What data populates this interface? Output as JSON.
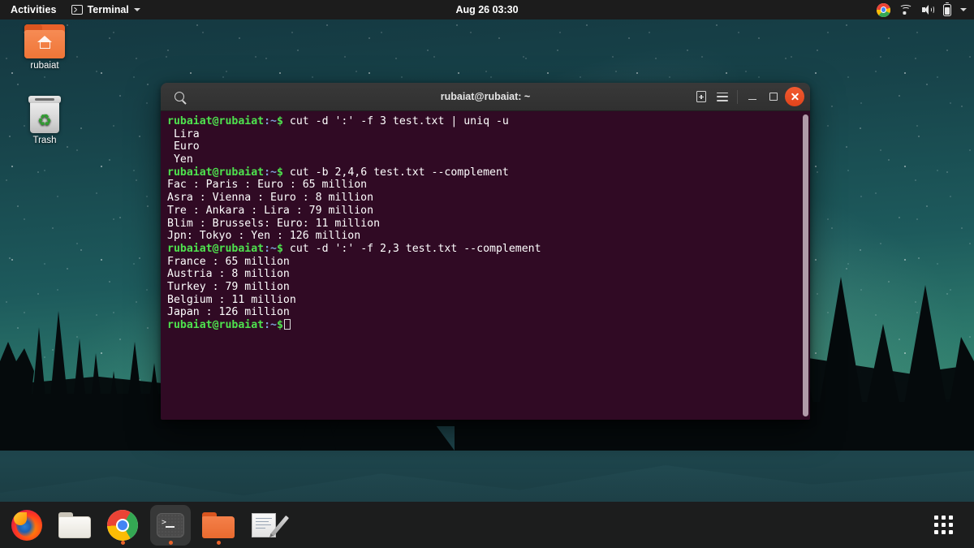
{
  "topbar": {
    "activities": "Activities",
    "app_menu": "Terminal",
    "app_icon": "terminal-icon",
    "clock": "Aug 26  03:30",
    "tray": [
      "chrome-icon",
      "wifi-icon",
      "volume-icon",
      "battery-icon",
      "chevron-down-icon"
    ]
  },
  "desktop_icons": [
    {
      "name": "rubaiat",
      "icon": "home-folder-icon"
    },
    {
      "name": "Trash",
      "icon": "trash-icon"
    }
  ],
  "terminal": {
    "title": "rubaiat@rubaiat: ~",
    "titlebar_buttons": {
      "search": "search-icon",
      "new_tab": "new-tab-icon",
      "menu": "hamburger-menu-icon",
      "minimize": "minimize-icon",
      "maximize": "maximize-icon",
      "close": "close-icon"
    },
    "colors": {
      "background": "#300a24",
      "prompt_user": "#4ee24e",
      "prompt_path": "#7f9fd6",
      "text": "#ffffff",
      "close_button": "#e2441b"
    },
    "prompt": {
      "user_host": "rubaiat@rubaiat",
      "path": ":~",
      "symbol": "$"
    },
    "lines": [
      {
        "type": "prompt",
        "command": " cut -d ':' -f 3 test.txt | uniq -u"
      },
      {
        "type": "output",
        "text": " Lira"
      },
      {
        "type": "output",
        "text": " Euro"
      },
      {
        "type": "output",
        "text": " Yen"
      },
      {
        "type": "prompt",
        "command": " cut -b 2,4,6 test.txt --complement"
      },
      {
        "type": "output",
        "text": "Fac : Paris : Euro : 65 million"
      },
      {
        "type": "output",
        "text": "Asra : Vienna : Euro : 8 million"
      },
      {
        "type": "output",
        "text": "Tre : Ankara : Lira : 79 million"
      },
      {
        "type": "output",
        "text": "Blim : Brussels: Euro: 11 million"
      },
      {
        "type": "output",
        "text": "Jpn: Tokyo : Yen : 126 million"
      },
      {
        "type": "prompt",
        "command": " cut -d ':' -f 2,3 test.txt --complement"
      },
      {
        "type": "output",
        "text": "France : 65 million"
      },
      {
        "type": "output",
        "text": "Austria : 8 million"
      },
      {
        "type": "output",
        "text": "Turkey : 79 million"
      },
      {
        "type": "output",
        "text": "Belgium : 11 million"
      },
      {
        "type": "output",
        "text": "Japan : 126 million"
      },
      {
        "type": "prompt",
        "command": "",
        "cursor": true
      }
    ]
  },
  "dock": {
    "items": [
      {
        "icon": "firefox-icon",
        "label": "Firefox",
        "running": false,
        "active": false
      },
      {
        "icon": "files-icon",
        "label": "Files",
        "running": false,
        "active": false
      },
      {
        "icon": "chrome-icon",
        "label": "Google Chrome",
        "running": true,
        "active": false
      },
      {
        "icon": "terminal-icon",
        "label": "Terminal",
        "running": true,
        "active": true
      },
      {
        "icon": "folder-icon",
        "label": "Folder",
        "running": true,
        "active": false
      },
      {
        "icon": "text-editor-icon",
        "label": "Text Editor",
        "running": false,
        "active": false
      }
    ],
    "show_apps": "show-applications-icon"
  }
}
